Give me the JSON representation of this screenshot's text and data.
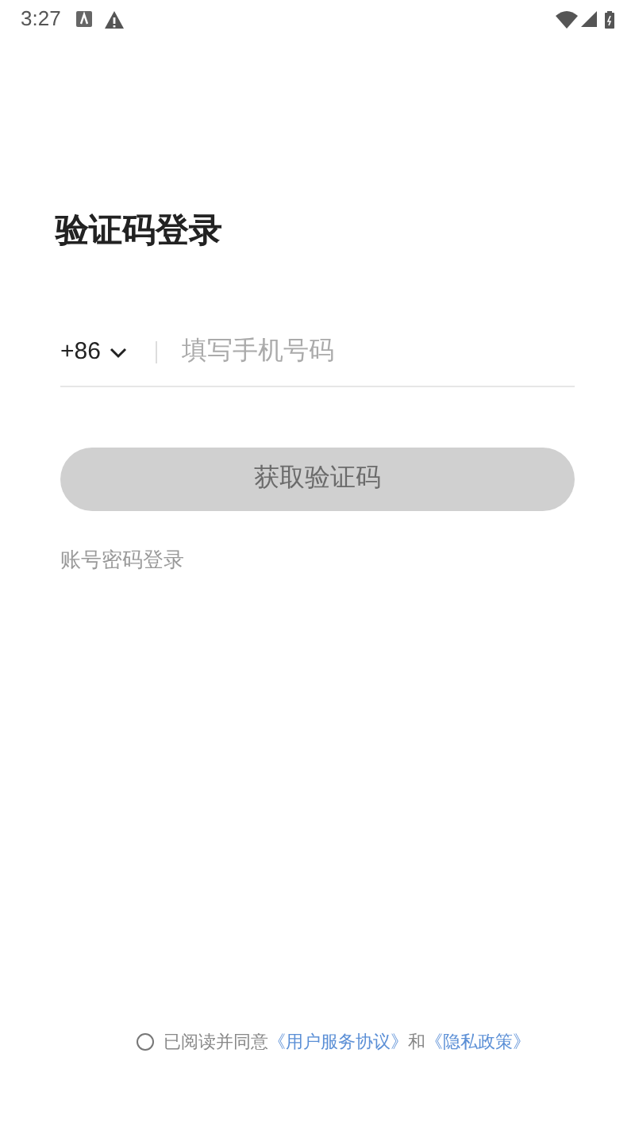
{
  "status_bar": {
    "time": "3:27"
  },
  "title": "验证码登录",
  "phone": {
    "country_code": "+86",
    "placeholder": "填写手机号码"
  },
  "get_code_button": {
    "label": "获取验证码",
    "disabled": true
  },
  "password_login_link": "账号密码登录",
  "agreement": {
    "checked": false,
    "parts": [
      {
        "kind": "text",
        "text": "已阅读并同意"
      },
      {
        "kind": "link",
        "text": "《用户服务协议》"
      },
      {
        "kind": "text",
        "text": "和"
      },
      {
        "kind": "link",
        "text": "《隐私政策》"
      }
    ]
  }
}
